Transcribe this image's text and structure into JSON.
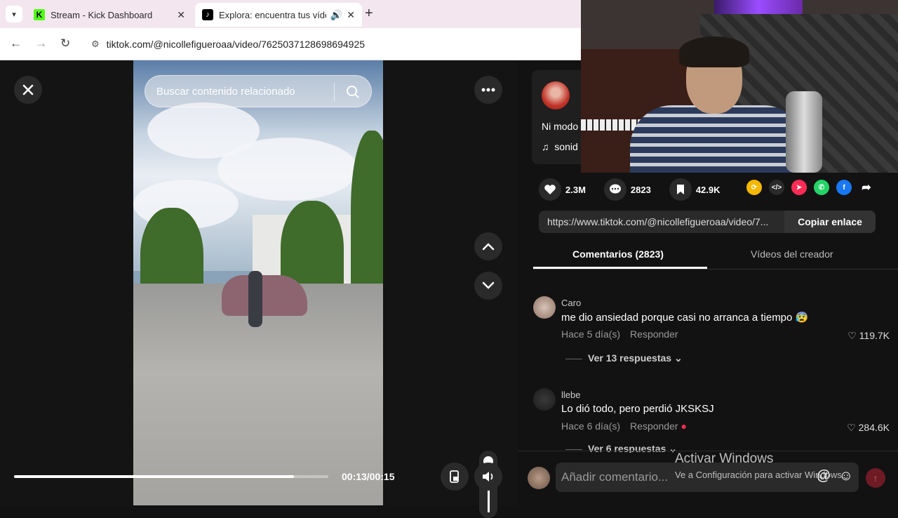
{
  "browser": {
    "tabs": [
      {
        "title": "Stream - Kick Dashboard",
        "favicon": "kick-icon"
      },
      {
        "title": "Explora: encuentra tus vídeos",
        "favicon": "tiktok-icon",
        "audio": true
      }
    ],
    "url": "tiktok.com/@nicollefigueroaa/video/7625037128698694925"
  },
  "viewer": {
    "search_placeholder": "Buscar contenido relacionado",
    "time": "00:13/00:15",
    "progress": 0.89,
    "volume": 1.0
  },
  "post": {
    "desc": "Ni modo",
    "music": "sonid",
    "likes": "2.3M",
    "comments": "2823",
    "saves": "42.9K",
    "link": "https://www.tiktok.com/@nicollefigueroaa/video/7...",
    "copy_label": "Copiar enlace"
  },
  "panel_tabs": {
    "comments": "Comentarios (2823)",
    "creator_videos": "Vídeos del creador"
  },
  "comments": [
    {
      "user": "Caro",
      "text": "me dio ansiedad porque casi no arranca a tiempo",
      "date": "Hace 5 día(s)",
      "reply": "Responder",
      "likes": "119.7K",
      "replies": "Ver 13 respuestas"
    },
    {
      "user": "llebe",
      "text": "Lo dió todo, pero perdió JKSKSJ",
      "date": "Hace 6 día(s)",
      "reply": "Responder",
      "likes": "284.6K",
      "replies": "Ver 6 respuestas"
    }
  ],
  "composer": {
    "placeholder": "Añadir comentario..."
  },
  "watermark": {
    "line1": "Activar Windows",
    "line2": "Ve a Configuración para activar Windows."
  },
  "colors": {
    "kick": "#53fc18",
    "tiktok_red": "#fe2c55",
    "panel_bg": "#121212"
  }
}
